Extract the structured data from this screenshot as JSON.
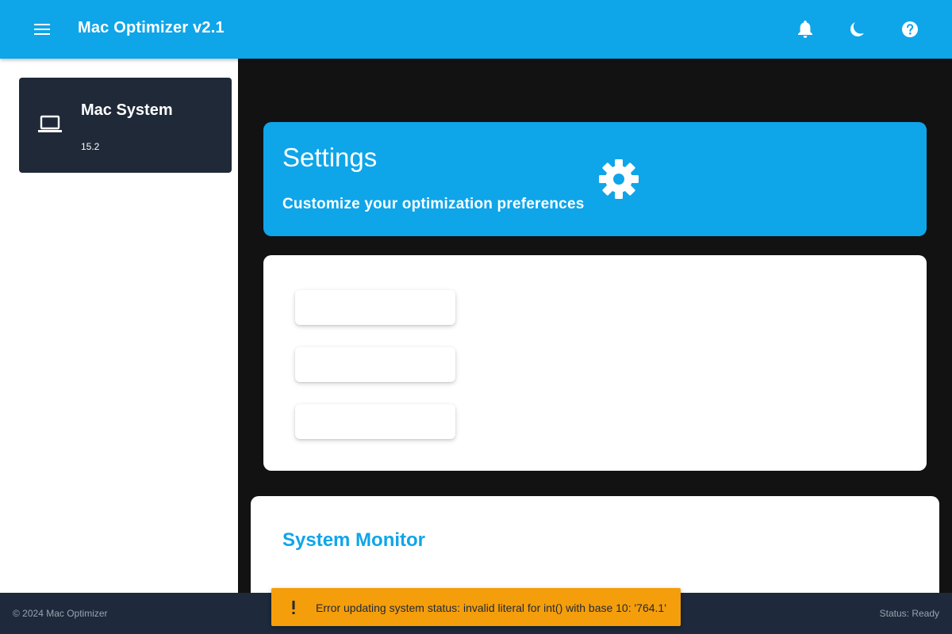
{
  "appbar": {
    "title": "Mac Optimizer v2.1",
    "icons": [
      "menu-icon",
      "bell-icon",
      "moon-icon",
      "help-icon"
    ]
  },
  "sidebar": {
    "system_card": {
      "icon": "laptop-icon",
      "name": "Mac System",
      "version": "15.2"
    }
  },
  "settings": {
    "title": "Settings",
    "subtitle": "Customize your optimization preferences",
    "icon": "gear-icon"
  },
  "monitor": {
    "title": "System Monitor"
  },
  "footer": {
    "copyright": "© 2024 Mac Optimizer",
    "status": "Status: Ready"
  },
  "snackbar": {
    "icon": "exclamation-icon",
    "message": "Error updating system status: invalid literal for int() with base 10: '764.1'"
  },
  "colors": {
    "primary": "#0fa5e9",
    "sidebar_card": "#1f2937",
    "footer": "#1e293b",
    "warning": "#f59e0b",
    "background": "#121212"
  }
}
